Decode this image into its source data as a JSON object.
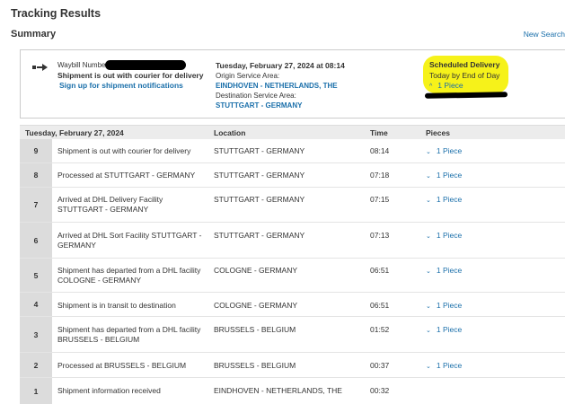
{
  "page": {
    "title": "Tracking Results"
  },
  "summary": {
    "heading": "Summary",
    "new_search": "New Search",
    "waybill_label": "Waybill Numbe",
    "status": "Shipment is out with courier for delivery",
    "signup_link": "Sign up for shipment notifications",
    "date": "Tuesday, February 27, 2024 at 08:14",
    "origin_label": "Origin Service Area:",
    "origin_value": "EINDHOVEN - NETHERLANDS, THE",
    "destination_label": "Destination Service Area:",
    "destination_value": "STUTTGART - GERMANY",
    "scheduled_title": "Scheduled Delivery",
    "scheduled_sub": "Today by End of Day",
    "scheduled_pieces": "1 Piece",
    "highlight_color": "#f6f21a"
  },
  "table": {
    "headers": {
      "date": "Tuesday, February 27, 2024",
      "location": "Location",
      "time": "Time",
      "pieces": "Pieces"
    },
    "rows": [
      {
        "num": "9",
        "desc": "Shipment is out with courier for delivery",
        "location": "STUTTGART - GERMANY",
        "time": "08:14",
        "pieces": "1 Piece"
      },
      {
        "num": "8",
        "desc": "Processed at STUTTGART - GERMANY",
        "location": "STUTTGART - GERMANY",
        "time": "07:18",
        "pieces": "1 Piece"
      },
      {
        "num": "7",
        "desc": "Arrived at DHL Delivery Facility STUTTGART - GERMANY",
        "location": "STUTTGART - GERMANY",
        "time": "07:15",
        "pieces": "1 Piece"
      },
      {
        "num": "6",
        "desc": "Arrived at DHL Sort Facility STUTTGART - GERMANY",
        "location": "STUTTGART - GERMANY",
        "time": "07:13",
        "pieces": "1 Piece"
      },
      {
        "num": "5",
        "desc": "Shipment has departed from a DHL facility COLOGNE - GERMANY",
        "location": "COLOGNE - GERMANY",
        "time": "06:51",
        "pieces": "1 Piece"
      },
      {
        "num": "4",
        "desc": "Shipment is in transit to destination",
        "location": "COLOGNE - GERMANY",
        "time": "06:51",
        "pieces": "1 Piece"
      },
      {
        "num": "3",
        "desc": "Shipment has departed from a DHL facility BRUSSELS - BELGIUM",
        "location": "BRUSSELS - BELGIUM",
        "time": "01:52",
        "pieces": "1 Piece"
      },
      {
        "num": "2",
        "desc": "Processed at BRUSSELS - BELGIUM",
        "location": "BRUSSELS - BELGIUM",
        "time": "00:37",
        "pieces": "1 Piece"
      },
      {
        "num": "1",
        "desc": "Shipment information received",
        "location": "EINDHOVEN - NETHERLANDS, THE",
        "time": "00:32",
        "pieces": ""
      }
    ]
  }
}
